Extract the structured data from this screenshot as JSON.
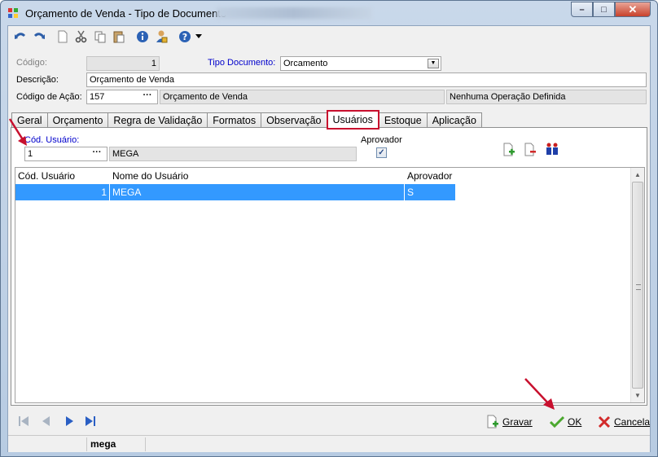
{
  "window": {
    "title": "Orçamento de Venda -  Tipo de Documento",
    "minimize_glyph": "–",
    "maximize_glyph": "□",
    "close_glyph": "✕"
  },
  "form": {
    "codigo_label": "Código:",
    "codigo_value": "1",
    "tipo_documento_label": "Tipo Documento:",
    "tipo_documento_value": "Orcamento",
    "descricao_label": "Descrição:",
    "descricao_value": "Orçamento de Venda",
    "codigo_acao_label": "Código de Ação:",
    "codigo_acao_value": "157",
    "codigo_acao_desc": "Orçamento de Venda",
    "operacao_desc": "Nenhuma Operação Definida",
    "lookup_glyph": "···"
  },
  "tabs": [
    {
      "label": "Geral"
    },
    {
      "label": "Orçamento"
    },
    {
      "label": "Regra de Validação"
    },
    {
      "label": "Formatos"
    },
    {
      "label": "Observação"
    },
    {
      "label": "Usuários",
      "active": true
    },
    {
      "label": "Estoque"
    },
    {
      "label": "Aplicação"
    }
  ],
  "usuarios": {
    "cod_usuario_label": "Cód. Usuário:",
    "cod_usuario_value": "1",
    "nome_usuario_value": "MEGA",
    "aprovador_label": "Aprovador",
    "aprovador_checked": "✓"
  },
  "grid": {
    "columns": [
      "Cód. Usuário",
      "Nome do Usuário",
      "Aprovador"
    ],
    "rows": [
      {
        "cod": "1",
        "nome": "MEGA",
        "aprovador": "S"
      }
    ]
  },
  "actions": {
    "gravar": "Gravar",
    "ok": "OK",
    "cancela": "Cancela"
  },
  "status": {
    "user": "mega"
  },
  "colors": {
    "accent_red": "#c8102e",
    "selection_blue": "#3399ff",
    "link_blue": "#0000cc"
  }
}
